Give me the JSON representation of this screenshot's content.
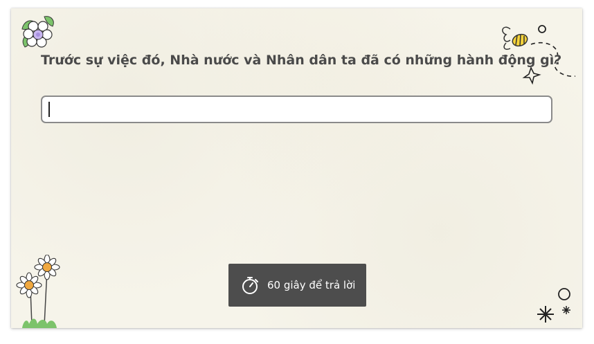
{
  "question": {
    "text": "Trước sự việc đó, Nhà nước và Nhân dân ta đã có những hành động gì?"
  },
  "answer": {
    "value": "",
    "placeholder": ""
  },
  "timer": {
    "label": "60 giây để trả lời",
    "icon": "stopwatch-icon"
  },
  "colors": {
    "background": "#f6f4ea",
    "timer_background": "#4d4d4d",
    "question_text": "#4a4a4a",
    "input_border": "#8a8a8a",
    "flower_center": "#f0a840",
    "bee_yellow": "#f5d33a",
    "leaf_green": "#7cc36b"
  }
}
